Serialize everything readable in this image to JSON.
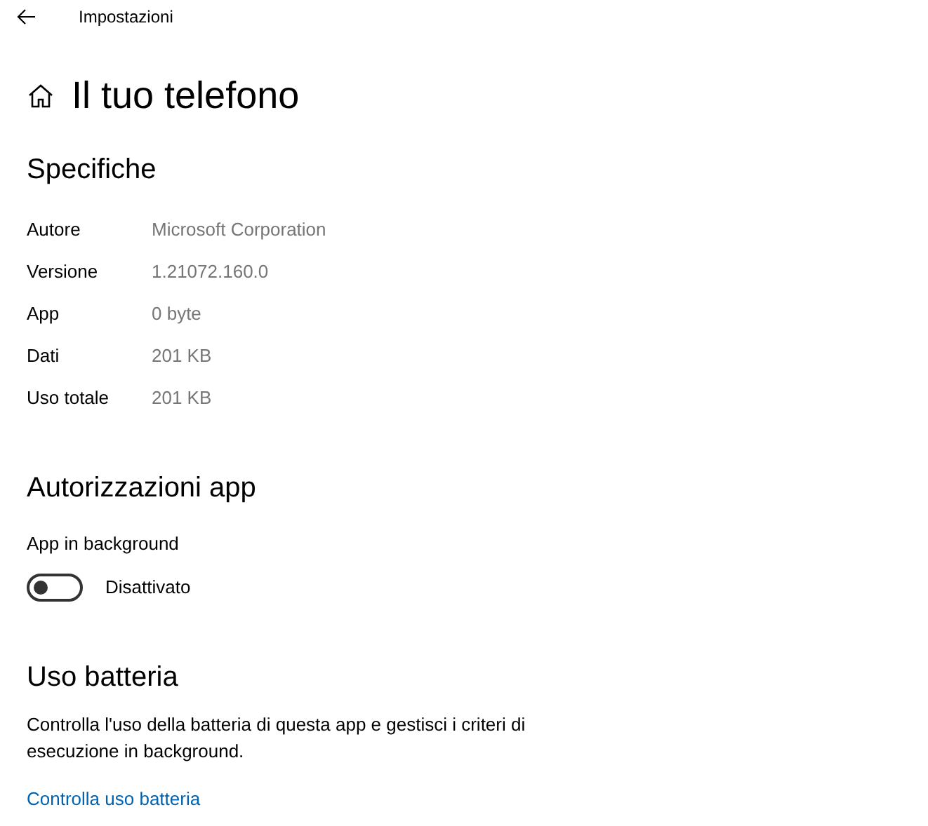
{
  "window": {
    "title": "Impostazioni"
  },
  "page": {
    "title": "Il tuo telefono"
  },
  "specs": {
    "heading": "Specifiche",
    "rows": [
      {
        "label": "Autore",
        "value": "Microsoft Corporation"
      },
      {
        "label": "Versione",
        "value": "1.21072.160.0"
      },
      {
        "label": "App",
        "value": "0 byte"
      },
      {
        "label": "Dati",
        "value": "201 KB"
      },
      {
        "label": "Uso totale",
        "value": "201 KB"
      }
    ]
  },
  "permissions": {
    "heading": "Autorizzazioni app",
    "setting": {
      "label": "App in background",
      "on": false,
      "state_label": "Disattivato"
    }
  },
  "battery": {
    "heading": "Uso batteria",
    "description": "Controlla l'uso della batteria di questa app e gestisci i criteri di esecuzione in background.",
    "link": "Controlla uso batteria"
  }
}
